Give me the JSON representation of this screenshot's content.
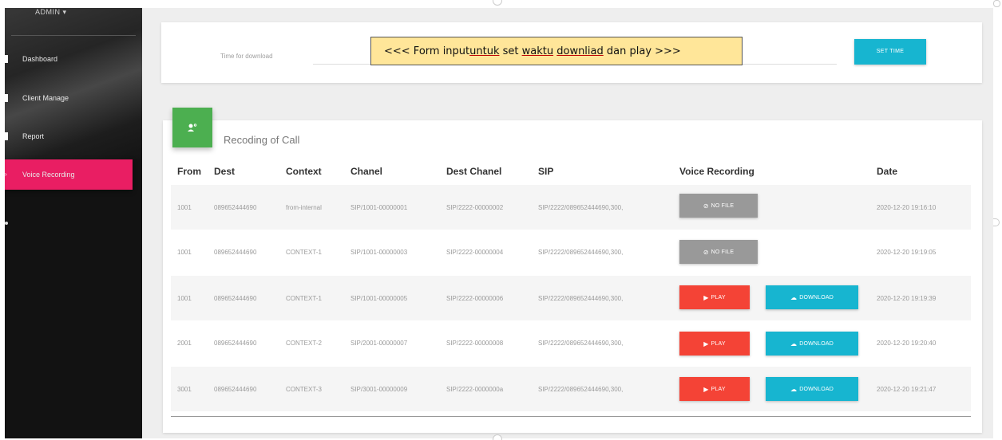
{
  "sidebar": {
    "user": "ADMIN ▾",
    "items": [
      {
        "label": "Dashboard"
      },
      {
        "label": "Client Manage"
      },
      {
        "label": "Report"
      },
      {
        "label": "Voice Recording",
        "active": true
      }
    ]
  },
  "time_form": {
    "placeholder": "Time for download",
    "callout": {
      "prefix": "<<< Form input ",
      "w1": "untuk",
      "mid1": " set ",
      "w2": "waktu",
      "mid2": " ",
      "w3": "downliad",
      "suffix": " dan play >>>"
    },
    "set_time_label": "SET TIME"
  },
  "recording_card": {
    "title": "Recoding of Call",
    "columns": [
      "From",
      "Dest",
      "Context",
      "Chanel",
      "Dest Chanel",
      "SIP",
      "Voice Recording",
      "Date"
    ],
    "rows": [
      {
        "from": "1001",
        "dest": "089652444690",
        "context": "from-internal",
        "chanel": "SIP/1001-00000001",
        "dest_chanel": "SIP/2222-00000002",
        "sip": "SIP/2222/089652444690,300,",
        "date": "2020-12-20 19:16:10",
        "recording": "nofile"
      },
      {
        "from": "1001",
        "dest": "089652444690",
        "context": "CONTEXT-1",
        "chanel": "SIP/1001-00000003",
        "dest_chanel": "SIP/2222-00000004",
        "sip": "SIP/2222/089652444690,300,",
        "date": "2020-12-20 19:19:05",
        "recording": "nofile"
      },
      {
        "from": "1001",
        "dest": "089652444690",
        "context": "CONTEXT-1",
        "chanel": "SIP/1001-00000005",
        "dest_chanel": "SIP/2222-00000006",
        "sip": "SIP/2222/089652444690,300,",
        "date": "2020-12-20 19:19:39",
        "recording": "play"
      },
      {
        "from": "2001",
        "dest": "089652444690",
        "context": "CONTEXT-2",
        "chanel": "SIP/2001-00000007",
        "dest_chanel": "SIP/2222-00000008",
        "sip": "SIP/2222/089652444690,300,",
        "date": "2020-12-20 19:20:40",
        "recording": "play"
      },
      {
        "from": "3001",
        "dest": "089652444690",
        "context": "CONTEXT-3",
        "chanel": "SIP/3001-00000009",
        "dest_chanel": "SIP/2222-0000000a",
        "sip": "SIP/2222/089652444690,300,",
        "date": "2020-12-20 19:21:47",
        "recording": "play"
      }
    ],
    "buttons": {
      "nofile": "NO FILE",
      "play": "PLAY",
      "download": "DOWNLOAD"
    }
  },
  "colors": {
    "sidebar_active": "#e91e63",
    "accent_cyan": "#17b5d0",
    "play_red": "#f44336",
    "card_icon_green": "#4caf50",
    "nofile_gray": "#999999"
  }
}
